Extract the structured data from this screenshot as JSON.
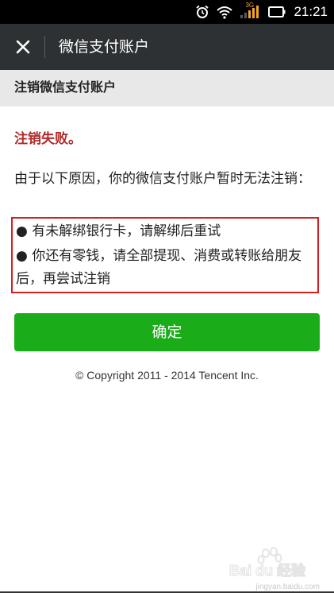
{
  "status_bar": {
    "time": "21:21",
    "network": "3G",
    "icons": [
      "alarm-icon",
      "wifi-icon",
      "signal-icon",
      "battery-icon"
    ]
  },
  "nav": {
    "title": "微信支付账户",
    "close_icon": "close-icon"
  },
  "section": {
    "header": "注销微信支付账户"
  },
  "content": {
    "fail_title": "注销失败。",
    "intro": "由于以下原因，你的微信支付账户暂时无法注销：",
    "reasons": [
      "有未解绑银行卡，请解绑后重试",
      "你还有零钱，请全部提现、消费或转账给朋友后，再尝试注销"
    ],
    "bullet": "●"
  },
  "confirm_button": {
    "label": "确定"
  },
  "footer": {
    "copyright": "© Copyright 2011 - 2014 Tencent Inc."
  },
  "watermark": {
    "text": "Bai du 经验",
    "url": "jingyan.baidu.com"
  },
  "colors": {
    "status_bar_bg": "#000000",
    "nav_bg": "#2e3133",
    "section_bg": "#e8e8e8",
    "fail_red": "#b22b2b",
    "highlight_border": "#d42020",
    "button_green": "#1aad19"
  }
}
